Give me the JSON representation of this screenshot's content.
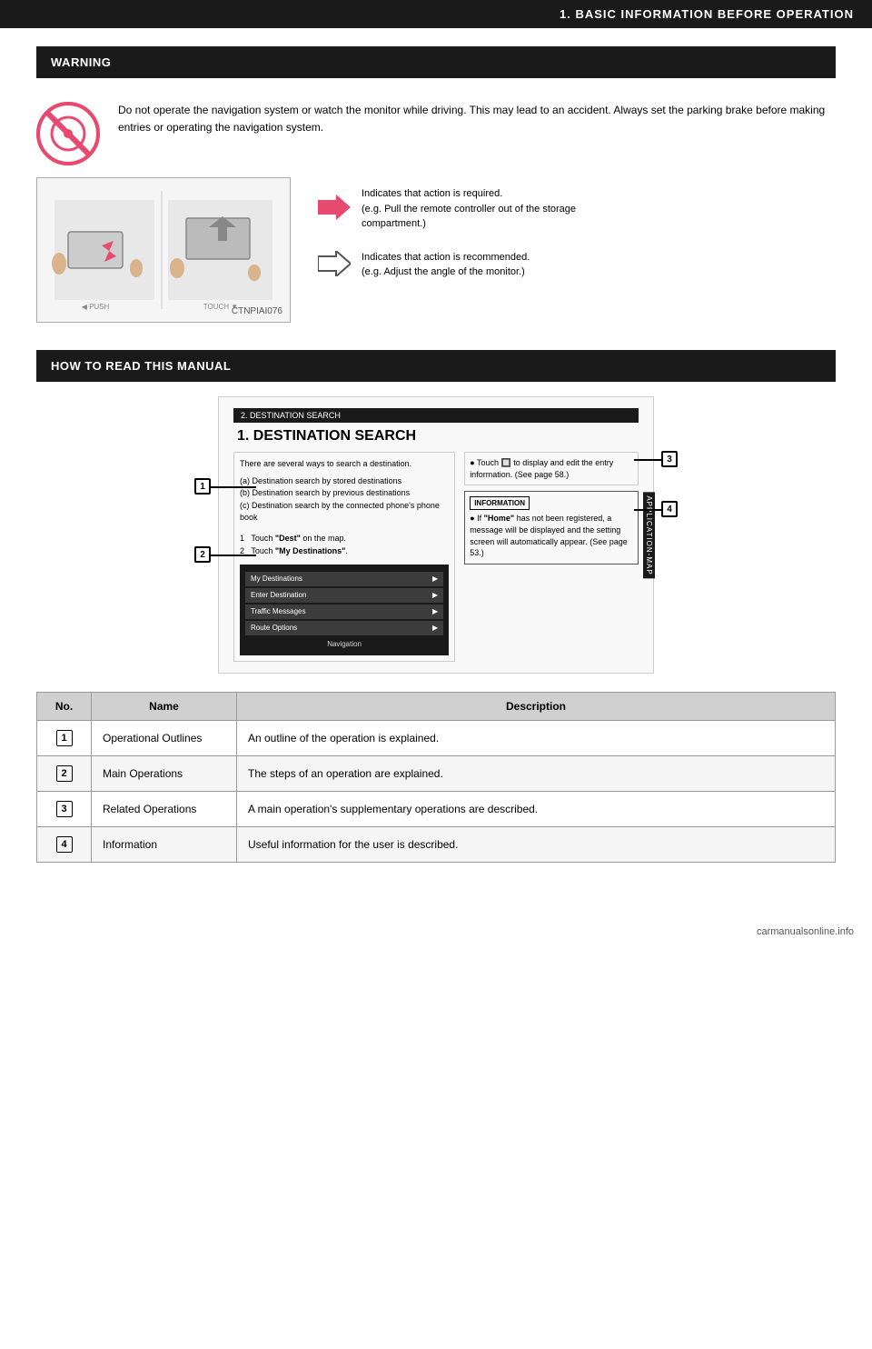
{
  "page": {
    "header": "1. BASIC INFORMATION BEFORE OPERATION",
    "footer_watermark": "carmanualsonline.info"
  },
  "section1": {
    "header_text": "WARNING",
    "warning_body": "Do not operate the navigation system or watch the monitor while driving. This may lead to an accident.\nAlways set the parking brake before making entries or operating the navigation system.",
    "arrow_filled_text_line1": "Indicates that action is required.",
    "arrow_filled_text_line2": "(e.g. Pull the remote controller out of the storage compartment.)",
    "arrow_outline_text_line1": "Indicates that action is recommended.",
    "arrow_outline_text_line2": "(e.g. Adjust the angle of the monitor.)",
    "diagram_label": "CTNPIAI076"
  },
  "section2": {
    "header_text": "HOW TO READ THIS MANUAL",
    "manual_inner_header": "2. DESTINATION SEARCH",
    "manual_title": "1. DESTINATION SEARCH",
    "manual_left_para1": "There are several ways to search a destination.",
    "manual_left_list": [
      "(a) Destination search by stored destinations",
      "(b) Destination search by previous destinations",
      "(c) Destination search by the connected phone's phone book"
    ],
    "manual_steps": [
      "1   Touch \"Dest\" on the map.",
      "2   Touch \"My Destinations\"."
    ],
    "manual_right_top": "● Touch         to display and edit the entry information. (See page 58.)",
    "manual_right_info_title": "INFORMATION",
    "manual_right_info_body": "● If \"Home\" has not been registered, a message will be displayed and the setting screen will automatically appear. (See page 53.)",
    "app_map_label": "APPLICATION-MAP",
    "screenshot_items": [
      "My Destinations",
      "Enter Destination",
      "Traffic Messages",
      "Route Options"
    ],
    "screenshot_footer": "Navigation"
  },
  "table": {
    "headers": [
      "No.",
      "Name",
      "Description"
    ],
    "rows": [
      {
        "no": "1",
        "name": "Operational Outlines",
        "description": "An outline of the operation is explained."
      },
      {
        "no": "2",
        "name": "Main Operations",
        "description": "The steps of an operation are explained."
      },
      {
        "no": "3",
        "name": "Related Operations",
        "description": "A main operation's supplementary operations are described."
      },
      {
        "no": "4",
        "name": "Information",
        "description": "Useful information for the user is described."
      }
    ]
  }
}
